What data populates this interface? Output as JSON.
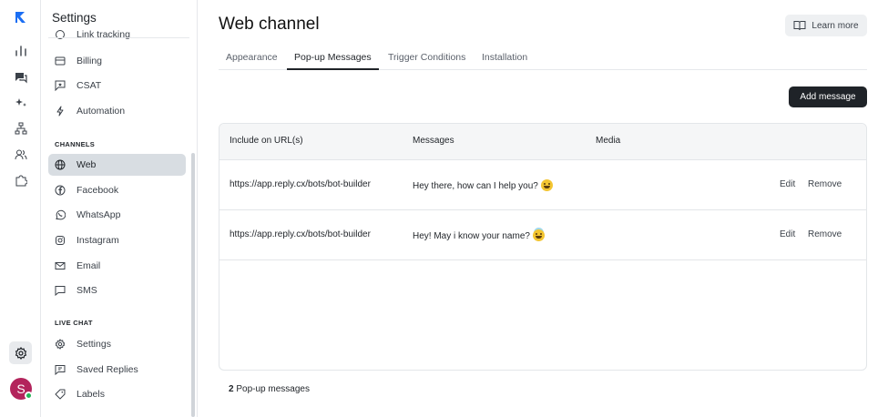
{
  "rail": {
    "items": [
      "logo",
      "analytics",
      "conversations",
      "ai",
      "bot-builder",
      "contacts",
      "integrations"
    ],
    "active": "settings",
    "avatar_initial": "S",
    "presence_color": "#22b455"
  },
  "sidebar": {
    "title": "Settings",
    "cut_item": "Link tracking",
    "items_top": [
      {
        "label": "Billing",
        "icon": "billing-icon"
      },
      {
        "label": "CSAT",
        "icon": "csat-icon"
      },
      {
        "label": "Automation",
        "icon": "lightning-icon"
      }
    ],
    "channels_heading": "CHANNELS",
    "channels": [
      {
        "label": "Web",
        "icon": "globe-icon",
        "active": true
      },
      {
        "label": "Facebook",
        "icon": "facebook-icon"
      },
      {
        "label": "WhatsApp",
        "icon": "whatsapp-icon"
      },
      {
        "label": "Instagram",
        "icon": "instagram-icon"
      },
      {
        "label": "Email",
        "icon": "mail-icon"
      },
      {
        "label": "SMS",
        "icon": "sms-icon"
      }
    ],
    "live_chat_heading": "LIVE CHAT",
    "live_chat": [
      {
        "label": "Settings",
        "icon": "gear-icon"
      },
      {
        "label": "Saved Replies",
        "icon": "saved-replies-icon"
      },
      {
        "label": "Labels",
        "icon": "label-icon"
      }
    ]
  },
  "main": {
    "title": "Web channel",
    "learn_more": "Learn more",
    "tabs": [
      {
        "label": "Appearance"
      },
      {
        "label": "Pop-up Messages",
        "active": true
      },
      {
        "label": "Trigger Conditions"
      },
      {
        "label": "Installation"
      }
    ],
    "add_button": "Add message",
    "table": {
      "headers": [
        "Include on URL(s)",
        "Messages",
        "Media"
      ],
      "rows": [
        {
          "url": "https://app.reply.cx/bots/bot-builder",
          "message": "Hey there, how can I help you?",
          "emoji": "grinning-face",
          "edit": "Edit",
          "remove": "Remove"
        },
        {
          "url": "https://app.reply.cx/bots/bot-builder",
          "message": "Hey! May i know your name?",
          "emoji": "smiling-face-with-halo",
          "edit": "Edit",
          "remove": "Remove"
        }
      ]
    },
    "footer": {
      "count": "2",
      "label": " Pop-up messages"
    }
  },
  "colors": {
    "accent": "#1b6ef3",
    "primary_button": "#1f2328",
    "active_nav": "#d8dde2"
  }
}
